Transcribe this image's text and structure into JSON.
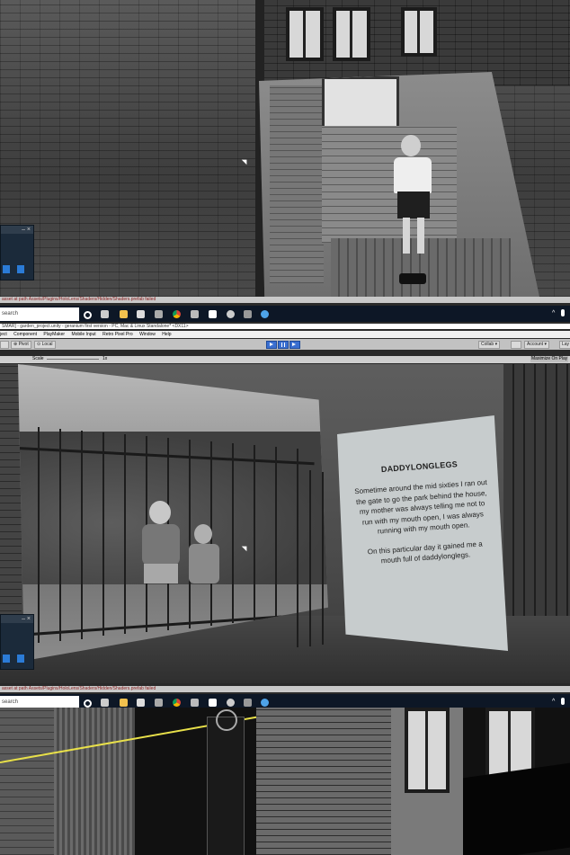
{
  "status_message": "asset at path Assets/Plugins/HoloLens/Shaders/Hidden/Shaders.prefab failed",
  "taskbar": {
    "search_label": "search",
    "icons": [
      "cortana-icon",
      "task-view-icon",
      "file-explorer-icon",
      "store-icon",
      "chrome-icon",
      "vlc-icon",
      "unity-icon",
      "audacity-icon",
      "steam-icon",
      "app-icon",
      "settings-icon"
    ],
    "tray": [
      "^",
      "mic"
    ]
  },
  "unity": {
    "title": "SMAR] - garden_project.unity - geranium first version - PC, Mac & Linux Standalone* <DX11>",
    "menu": [
      "ject",
      "Component",
      "PlayMaker",
      "Mobile Input",
      "Retro Pixel Pro",
      "Window",
      "Help"
    ],
    "pivot_label": "Pivot",
    "local_label": "Local",
    "collab_label": "Collab",
    "account_label": "Account",
    "layers_label": "Lay",
    "scale_label": "Scale",
    "scale_value": "1x",
    "maximize_label": "Maximize On Play"
  },
  "panel": {
    "title": "DADDYLONGLEGS",
    "paragraph1": "Sometime around the mid sixties I ran out the gate to go the park behind the house, my mother was always telling me not to run with my mouth open, I was always running with my mouth open.",
    "paragraph2": "On this particular day it gained me a mouth full of daddylonglegs."
  },
  "colors": {
    "taskbar": "#0d1726",
    "play_accent": "#3a6fd1",
    "status_text": "#8a2020",
    "guide_line": "#e8e04a"
  }
}
